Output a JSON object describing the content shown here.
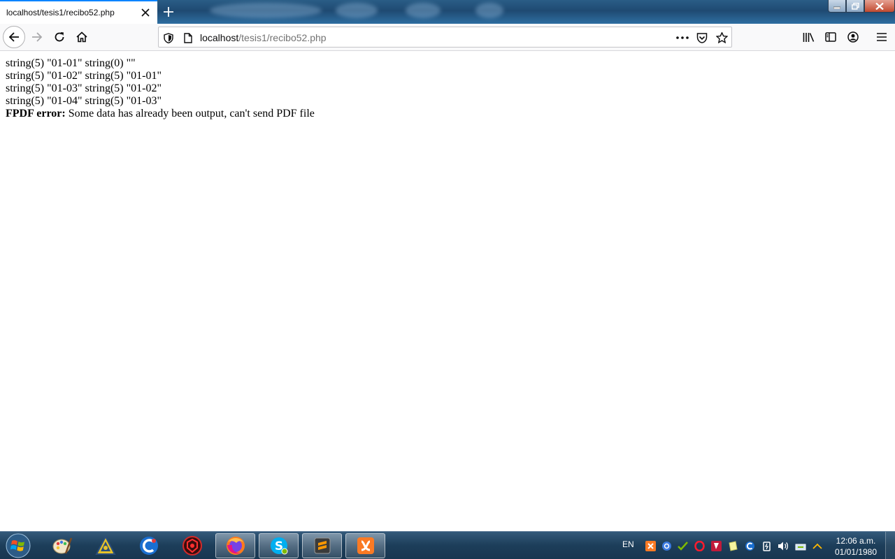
{
  "browser": {
    "tab": {
      "title": "localhost/tesis1/recibo52.php"
    },
    "url": {
      "host": "localhost",
      "path": "/tesis1/recibo52.php"
    }
  },
  "page": {
    "lines": [
      "string(5) \"01-01\" string(0) \"\"",
      "string(5) \"01-02\" string(5) \"01-01\"",
      "string(5) \"01-03\" string(5) \"01-02\"",
      "string(5) \"01-04\" string(5) \"01-03\""
    ],
    "error": {
      "label": "FPDF error:",
      "message": " Some data has already been output, can't send PDF file"
    }
  },
  "taskbar": {
    "pinned": [
      "windows-start-icon",
      "paint-icon",
      "arduino-icon",
      "ccleaner-icon",
      "antivirus-icon",
      "firefox-icon",
      "skype-icon",
      "sublime-text-icon",
      "xampp-icon"
    ],
    "language": "EN",
    "clock": {
      "time": "12:06 a.m.",
      "date": "01/01/1980"
    }
  },
  "colors": {
    "accent": "#0a84ff",
    "taskbar": "#1d3e5a",
    "toolbar": "#f9f9fa"
  }
}
